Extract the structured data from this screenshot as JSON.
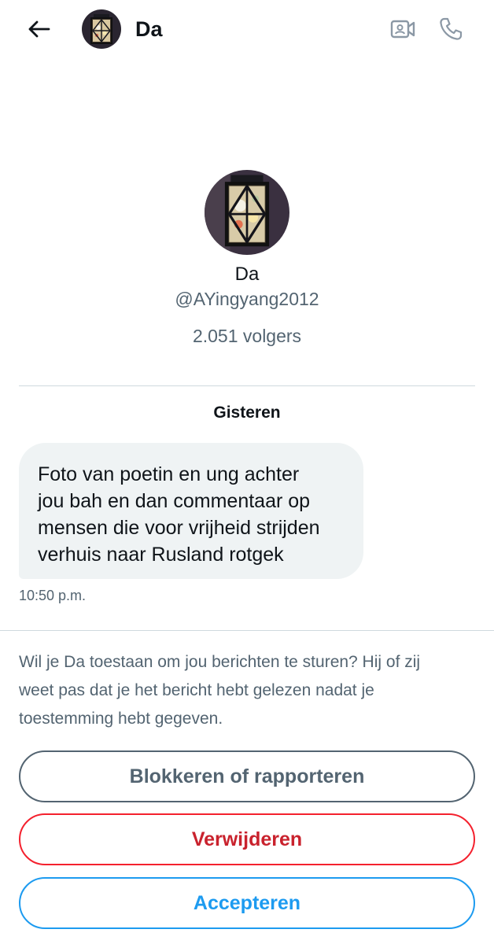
{
  "header": {
    "title": "Da",
    "back_icon": "arrow-left-icon",
    "video_icon": "video-call-icon",
    "call_icon": "phone-icon"
  },
  "profile": {
    "name": "Da",
    "handle": "@AYingyang2012",
    "followers": "2.051 volgers",
    "avatar_description": "lantern-photo"
  },
  "conversation": {
    "date_separator": "Gisteren",
    "messages": [
      {
        "text_lines": [
          "Foto van poetin en ung achter",
          "jou bah en dan commentaar op",
          "mensen die voor vrijheid strijden",
          "verhuis naar Rusland rotgek"
        ],
        "time": "10:50 p.m."
      }
    ]
  },
  "request": {
    "text_lines": [
      "Wil je Da toestaan om jou berichten te sturen? Hij of zij",
      "weet pas dat je het bericht hebt gelezen nadat je",
      "toestemming hebt gegeven."
    ],
    "block_label": "Blokkeren of rapporteren",
    "delete_label": "Verwijderen",
    "accept_label": "Accepteren"
  },
  "colors": {
    "text_primary": "#0f1419",
    "text_secondary": "#536471",
    "bubble_bg": "#eff3f4",
    "danger": "#f4212e",
    "accent": "#1d9bf0",
    "divider": "#cfd9de"
  }
}
